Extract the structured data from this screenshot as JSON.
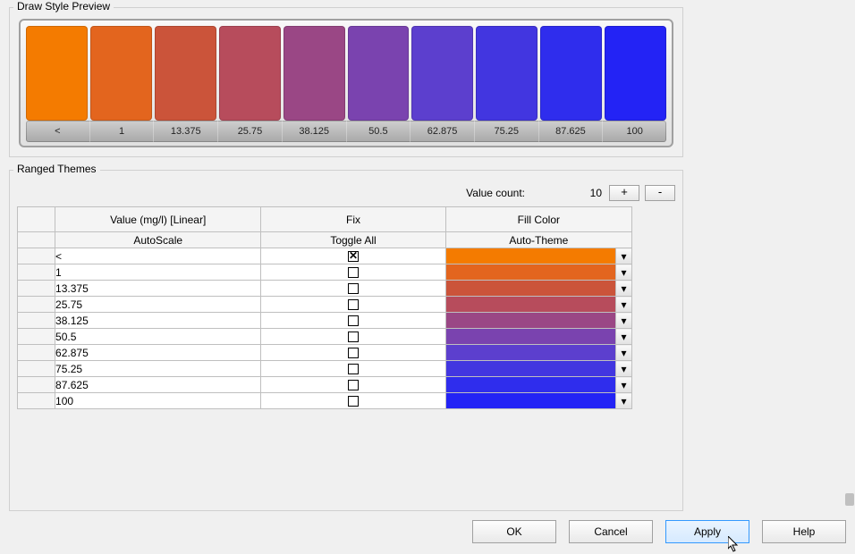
{
  "preview": {
    "title": "Draw Style Preview",
    "swatches": [
      {
        "label": "<",
        "color": "#f47b00"
      },
      {
        "label": "1",
        "color": "#e3651e"
      },
      {
        "label": "13.375",
        "color": "#cb543a"
      },
      {
        "label": "25.75",
        "color": "#b74c5c"
      },
      {
        "label": "38.125",
        "color": "#9a4785"
      },
      {
        "label": "50.5",
        "color": "#7a43af"
      },
      {
        "label": "62.875",
        "color": "#5c3fce"
      },
      {
        "label": "75.25",
        "color": "#4236e0"
      },
      {
        "label": "87.625",
        "color": "#2f2ded"
      },
      {
        "label": "100",
        "color": "#2323f5"
      }
    ]
  },
  "ranged": {
    "title": "Ranged Themes",
    "value_count_label": "Value count:",
    "value_count": "10",
    "plus": "+",
    "minus": "-",
    "headers": {
      "value": "Value (mg/l) [Linear]",
      "fix": "Fix",
      "fill": "Fill Color",
      "autoscale": "AutoScale",
      "toggle": "Toggle All",
      "autotheme": "Auto-Theme"
    },
    "rows": [
      {
        "value": "<",
        "fixed": true,
        "color": "#f47b00"
      },
      {
        "value": "1",
        "fixed": false,
        "color": "#e3651e"
      },
      {
        "value": "13.375",
        "fixed": false,
        "color": "#cb543a"
      },
      {
        "value": "25.75",
        "fixed": false,
        "color": "#b74c5c"
      },
      {
        "value": "38.125",
        "fixed": false,
        "color": "#9a4785"
      },
      {
        "value": "50.5",
        "fixed": false,
        "color": "#7a43af"
      },
      {
        "value": "62.875",
        "fixed": false,
        "color": "#5c3fce"
      },
      {
        "value": "75.25",
        "fixed": false,
        "color": "#4236e0"
      },
      {
        "value": "87.625",
        "fixed": false,
        "color": "#2f2ded"
      },
      {
        "value": "100",
        "fixed": false,
        "color": "#2323f5"
      }
    ]
  },
  "buttons": {
    "ok": "OK",
    "cancel": "Cancel",
    "apply": "Apply",
    "help": "Help"
  },
  "chart_data": {
    "type": "bar",
    "title": "Draw Style Preview — color ramp over value range",
    "xlabel": "Value (mg/l) [Linear]",
    "ylabel": "",
    "categories": [
      "<",
      "1",
      "13.375",
      "25.75",
      "38.125",
      "50.5",
      "62.875",
      "75.25",
      "87.625",
      "100"
    ],
    "series": [
      {
        "name": "Fill Color",
        "values": [
          "#f47b00",
          "#e3651e",
          "#cb543a",
          "#b74c5c",
          "#9a4785",
          "#7a43af",
          "#5c3fce",
          "#4236e0",
          "#2f2ded",
          "#2323f5"
        ]
      }
    ],
    "ylim": null
  }
}
